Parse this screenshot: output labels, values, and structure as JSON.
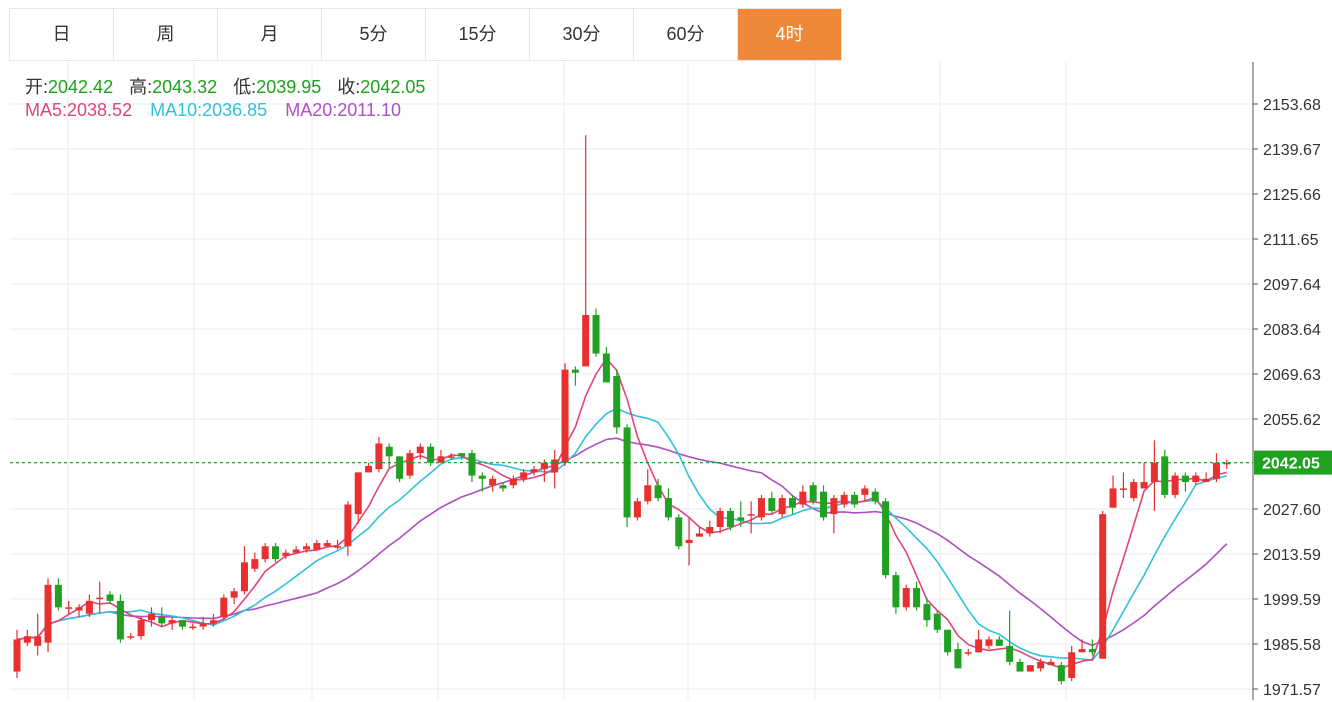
{
  "tabs": [
    {
      "label": "日"
    },
    {
      "label": "周"
    },
    {
      "label": "月"
    },
    {
      "label": "5分"
    },
    {
      "label": "15分"
    },
    {
      "label": "30分"
    },
    {
      "label": "60分"
    },
    {
      "label": "4时"
    }
  ],
  "active_tab": 7,
  "ohlc": {
    "open_label": "开:",
    "open": "2042.42",
    "high_label": "高:",
    "high": "2043.32",
    "low_label": "低:",
    "low": "2039.95",
    "close_label": "收:",
    "close": "2042.05"
  },
  "ma": {
    "ma5_label": "MA5:",
    "ma5": "2038.52",
    "ma10_label": "MA10:",
    "ma10": "2036.85",
    "ma20_label": "MA20:",
    "ma20": "2011.10"
  },
  "colors": {
    "up": "#e8302e",
    "down": "#21a121",
    "ma5": "#e0457b",
    "ma10": "#31c2d6",
    "ma20": "#b04ec3",
    "grid": "#e5eef4",
    "tab_active": "#f0883a",
    "last_price": "#21a121"
  },
  "chart_data": {
    "type": "candlestick",
    "y_ticks": [
      "2153.68",
      "2139.67",
      "2125.66",
      "2111.65",
      "2097.64",
      "2083.64",
      "2069.63",
      "2055.62",
      "2027.60",
      "2013.59",
      "1999.59",
      "1985.58",
      "1971.57"
    ],
    "ylim": [
      1971.57,
      2153.68
    ],
    "last_price": "2042.05",
    "candles": [
      [
        1977,
        1987,
        1975,
        1990
      ],
      [
        1986,
        1988,
        1985,
        1990
      ],
      [
        1985,
        1988,
        1982,
        1995
      ],
      [
        1986,
        2004,
        1983,
        2006
      ],
      [
        2004,
        1997,
        1996,
        2006
      ],
      [
        1997,
        1997,
        1995,
        1999
      ],
      [
        1996,
        1997,
        1994,
        1998
      ],
      [
        1995,
        1999,
        1994,
        2001
      ],
      [
        2000,
        2000,
        1995,
        2005
      ],
      [
        2001,
        1999,
        1998,
        2002
      ],
      [
        1999,
        1987,
        1986,
        2001
      ],
      [
        1988,
        1988,
        1987,
        1989
      ],
      [
        1988,
        1993,
        1987,
        1994
      ],
      [
        1993,
        1995,
        1991,
        1997
      ],
      [
        1994,
        1992,
        1991,
        1997
      ],
      [
        1992,
        1993,
        1990,
        1994
      ],
      [
        1993,
        1991,
        1990,
        1993
      ],
      [
        1991,
        1991,
        1990,
        1992
      ],
      [
        1991,
        1992,
        1990,
        1994
      ],
      [
        1992,
        1993,
        1991,
        1995
      ],
      [
        1994,
        2000,
        1993,
        2001
      ],
      [
        2000,
        2002,
        1998,
        2003
      ],
      [
        2002,
        2011,
        2001,
        2016
      ],
      [
        2009,
        2012,
        2008,
        2014
      ],
      [
        2012,
        2016,
        2011,
        2017
      ],
      [
        2016,
        2012,
        2011,
        2017
      ],
      [
        2013,
        2014,
        2012,
        2015
      ],
      [
        2014,
        2015,
        2014,
        2016
      ],
      [
        2015,
        2016,
        2014,
        2017
      ],
      [
        2015,
        2017,
        2015,
        2018
      ],
      [
        2016,
        2017,
        2016,
        2018
      ],
      [
        2016,
        2016,
        2015,
        2018
      ],
      [
        2016,
        2029,
        2013,
        2030
      ],
      [
        2026,
        2039,
        2023,
        2039
      ],
      [
        2039,
        2041,
        2039,
        2042
      ],
      [
        2040,
        2048,
        2039,
        2050
      ],
      [
        2047,
        2044,
        2040,
        2048
      ],
      [
        2044,
        2037,
        2036,
        2044
      ],
      [
        2038,
        2045,
        2037,
        2046
      ],
      [
        2045,
        2047,
        2043,
        2048
      ],
      [
        2047,
        2042,
        2041,
        2048
      ],
      [
        2042,
        2044,
        2043,
        2046
      ],
      [
        2044,
        2044,
        2043,
        2045
      ],
      [
        2045,
        2044,
        2043,
        2045
      ],
      [
        2045,
        2038,
        2036,
        2046
      ],
      [
        2038,
        2037,
        2033,
        2039
      ],
      [
        2035,
        2037,
        2033,
        2038
      ],
      [
        2035,
        2034,
        2033,
        2036
      ],
      [
        2035,
        2037,
        2034,
        2038
      ],
      [
        2037,
        2039,
        2036,
        2040
      ],
      [
        2039,
        2040,
        2038,
        2041
      ],
      [
        2040,
        2042,
        2036,
        2043
      ],
      [
        2039,
        2043,
        2034,
        2046
      ],
      [
        2042,
        2071,
        2041,
        2073
      ],
      [
        2071,
        2070,
        2066,
        2072
      ],
      [
        2072,
        2088,
        2072,
        2144
      ],
      [
        2088,
        2076,
        2075,
        2090
      ],
      [
        2076,
        2067,
        2067,
        2078
      ],
      [
        2069,
        2053,
        2051,
        2071
      ],
      [
        2053,
        2025,
        2022,
        2054
      ],
      [
        2025,
        2030,
        2024,
        2031
      ],
      [
        2030,
        2035,
        2029,
        2040
      ],
      [
        2035,
        2031,
        2030,
        2037
      ],
      [
        2031,
        2025,
        2024,
        2034
      ],
      [
        2025,
        2016,
        2015,
        2026
      ],
      [
        2017,
        2018,
        2010,
        2025
      ],
      [
        2019,
        2020,
        2019,
        2022
      ],
      [
        2020,
        2022,
        2019,
        2024
      ],
      [
        2022,
        2027,
        2020,
        2028
      ],
      [
        2027,
        2022,
        2021,
        2028
      ],
      [
        2025,
        2024,
        2022,
        2030
      ],
      [
        2026,
        2026,
        2020,
        2030
      ],
      [
        2025,
        2031,
        2024,
        2032
      ],
      [
        2031,
        2027,
        2026,
        2033
      ],
      [
        2026,
        2031,
        2025,
        2032
      ],
      [
        2031,
        2028,
        2026,
        2032
      ],
      [
        2029,
        2033,
        2028,
        2035
      ],
      [
        2035,
        2030,
        2029,
        2036
      ],
      [
        2033,
        2025,
        2024,
        2035
      ],
      [
        2026,
        2031,
        2020,
        2032
      ],
      [
        2029,
        2032,
        2028,
        2033
      ],
      [
        2032,
        2029,
        2028,
        2033
      ],
      [
        2032,
        2034,
        2030,
        2035
      ],
      [
        2033,
        2030,
        2029,
        2034
      ],
      [
        2030,
        2007,
        2006,
        2031
      ],
      [
        2007,
        1997,
        1995,
        2008
      ],
      [
        1997,
        2003,
        1996,
        2004
      ],
      [
        2003,
        1997,
        1996,
        2005
      ],
      [
        1998,
        1993,
        1991,
        2000
      ],
      [
        1995,
        1990,
        1989,
        1996
      ],
      [
        1990,
        1983,
        1982,
        1990
      ],
      [
        1984,
        1978,
        1978,
        1986
      ],
      [
        1983,
        1983,
        1982,
        1984
      ],
      [
        1983,
        1987,
        1983,
        1990
      ],
      [
        1985,
        1987,
        1984,
        1988
      ],
      [
        1987,
        1985,
        1985,
        1988
      ],
      [
        1985,
        1980,
        1979,
        1996
      ],
      [
        1980,
        1977,
        1977,
        1981
      ],
      [
        1977,
        1979,
        1977,
        1979
      ],
      [
        1978,
        1980,
        1977,
        1981
      ],
      [
        1979,
        1980,
        1979,
        1981
      ],
      [
        1979,
        1974,
        1973,
        1980
      ],
      [
        1975,
        1983,
        1974,
        1985
      ],
      [
        1983,
        1984,
        1983,
        1987
      ],
      [
        1984,
        1983,
        1982,
        1987
      ],
      [
        1981,
        2026,
        1981,
        2027
      ],
      [
        2028,
        2034,
        2028,
        2038
      ],
      [
        2034,
        2034,
        2031,
        2039
      ],
      [
        2031,
        2036,
        2030,
        2037
      ],
      [
        2034,
        2036,
        2034,
        2042
      ],
      [
        2036,
        2042,
        2027,
        2049
      ],
      [
        2044,
        2032,
        2031,
        2046
      ],
      [
        2032,
        2038,
        2031,
        2039
      ],
      [
        2038,
        2036,
        2033,
        2039
      ],
      [
        2036,
        2038,
        2035,
        2039
      ],
      [
        2036,
        2037,
        2036,
        2039
      ],
      [
        2037,
        2042,
        2036,
        2045
      ],
      [
        2042,
        2042,
        2040,
        2043
      ]
    ]
  }
}
